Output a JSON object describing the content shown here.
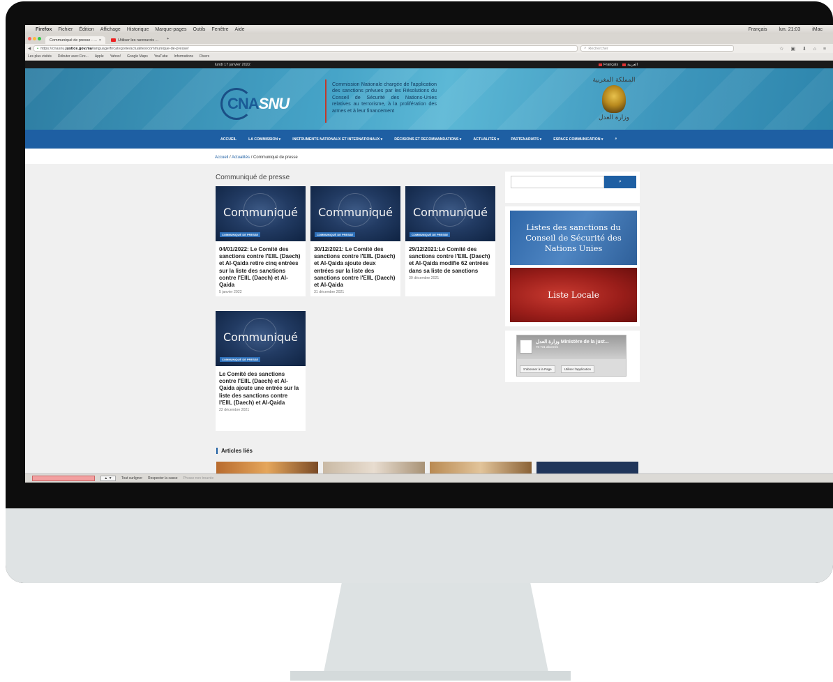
{
  "mac_menu": {
    "app": "Firefox",
    "items": [
      "Fichier",
      "Édition",
      "Affichage",
      "Historique",
      "Marque-pages",
      "Outils",
      "Fenêtre",
      "Aide"
    ],
    "status": [
      "Français",
      "lun. 21:03",
      "iMac"
    ]
  },
  "browser": {
    "tabs": [
      {
        "label": "Communiqué de presse - ..."
      },
      {
        "label": "Utiliser les raccourcis ..."
      }
    ],
    "url_prefix": "https://cnasnu.",
    "url_host": "justice.gov.ma",
    "url_path": "/language/fr/categorie/actualites/communique-de-presse/",
    "search_placeholder": "Rechercher",
    "bookmarks": [
      "Les plus visités",
      "Débuter avec Fire...",
      "Apple",
      "Yahoo!",
      "Google Maps",
      "YouTube",
      "Informations",
      "Divers"
    ]
  },
  "site": {
    "date": "lundi 17 janvier 2022",
    "lang_fr": "Français",
    "lang_ar": "العربية",
    "logo_left": "CNA",
    "logo_right": "SNU",
    "mission": "Commission Nationale chargée de l'application des sanctions prévues par les Résolutions du Conseil de Sécurité des Nations-Unies relatives au terrorisme, à la prolifération des armes et à leur financement",
    "emblem_top": "المملكة المغربية",
    "emblem_bottom": "وزارة العدل",
    "nav": [
      "ACCUEIL",
      "LA COMMISSION ▾",
      "INSTRUMENTS NATIONAUX ET INTERNATIONAUX ▾",
      "DÉCISIONS ET RECOMMANDATIONS ▾",
      "ACTUALITÉS ▾",
      "PARTENARIATS ▾",
      "ESPACE COMMUNICATION ▾",
      "⌕"
    ],
    "breadcrumb": {
      "home": "Accueil",
      "sep1": " / ",
      "section": "Actualités",
      "sep2": " / ",
      "current": "Communiqué de presse"
    },
    "section_title": "Communiqué de presse",
    "thumb_word": "Communiqué",
    "thumb_badge": "COMMUNIQUÉ DE PRESSE",
    "articles": [
      {
        "title": "04/01/2022: Le Comité des sanctions contre l'EIIL (Daech) et Al-Qaida retire cinq entrées sur la liste des sanctions contre l'EIIL (Daech) et Al-Qaida",
        "date": "5 janvier 2022"
      },
      {
        "title": "30/12/2021: Le Comité des sanctions contre l'EIIL (Daech) et Al-Qaida ajoute deux entrées sur la liste des sanctions contre l'EIIL (Daech) et Al-Qaida",
        "date": "31 décembre 2021"
      },
      {
        "title": "29/12/2021:Le Comité des sanctions contre l'EIIL (Daech) et Al-Qaida modifie 62 entrées dans sa liste de sanctions",
        "date": "30 décembre 2021"
      },
      {
        "title": "Le Comité des sanctions contre l'EIIL (Daech) et Al-Qaida ajoute une entrée sur la liste des sanctions contre l'EIIL (Daech) et Al-Qaida",
        "date": "22 décembre 2021"
      }
    ],
    "sidebar": {
      "search_button": "⌕",
      "banner_un": "Listes des sanctions du Conseil de Sécurité des Nations Unies",
      "banner_local": "Liste Locale",
      "fb_name": "وزارة العدل Ministère de la just...",
      "fb_subs": "70 731 abonnés",
      "fb_follow": "S'abonner à la Page",
      "fb_app": "Utiliser l'application"
    },
    "related_title": "Articles liés"
  },
  "findbar": {
    "highlight_all": "Tout surligner",
    "match_case": "Respecter la casse",
    "status": "Phrase non trouvée"
  },
  "colors": {
    "nav_blue": "#1e5fa3",
    "accent_red": "#c0392b"
  }
}
